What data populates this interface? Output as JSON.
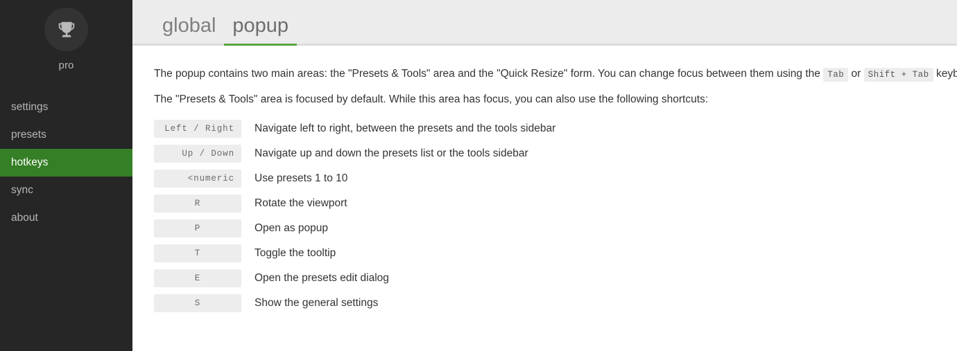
{
  "sidebar": {
    "avatar_icon": "trophy-icon",
    "profile_name": "pro",
    "items": [
      {
        "label": "settings",
        "active": false
      },
      {
        "label": "presets",
        "active": false
      },
      {
        "label": "hotkeys",
        "active": true
      },
      {
        "label": "sync",
        "active": false
      },
      {
        "label": "about",
        "active": false
      }
    ]
  },
  "tabs": [
    {
      "label": "global",
      "active": false
    },
    {
      "label": "popup",
      "active": true
    }
  ],
  "paragraphs": {
    "intro_part1": "The popup contains two main areas: the \"Presets & Tools\" area and the \"Quick Resize\" form. You can change focus between them using the ",
    "intro_code1": "Tab",
    "intro_mid": " or ",
    "intro_code2": "Shift + Tab",
    "intro_part2": " keyboard shortcuts.",
    "focus_note": "The \"Presets & Tools\" area is focused by default. While this area has focus, you can also use the following shortcuts:"
  },
  "hotkeys": [
    {
      "key": "Left / Right",
      "align": "right",
      "description": "Navigate left to right, between the presets and the tools sidebar"
    },
    {
      "key": "Up / Down",
      "align": "right",
      "description": "Navigate up and down the presets list or the tools sidebar"
    },
    {
      "key": "<numeric keys>",
      "align": "right",
      "description": "Use presets 1 to 10"
    },
    {
      "key": "R",
      "align": "center",
      "description": "Rotate the viewport"
    },
    {
      "key": "P",
      "align": "center",
      "description": "Open as popup"
    },
    {
      "key": "T",
      "align": "center",
      "description": "Toggle the tooltip"
    },
    {
      "key": "E",
      "align": "center",
      "description": "Open the presets edit dialog"
    },
    {
      "key": "S",
      "align": "center",
      "description": "Show the general settings"
    }
  ],
  "colors": {
    "sidebar_bg": "#262626",
    "sidebar_active_green": "#357f26",
    "tab_underline_green": "#5ba343",
    "tabbar_bg": "#ececec",
    "code_bg": "#ededed",
    "body_text": "#333333"
  }
}
